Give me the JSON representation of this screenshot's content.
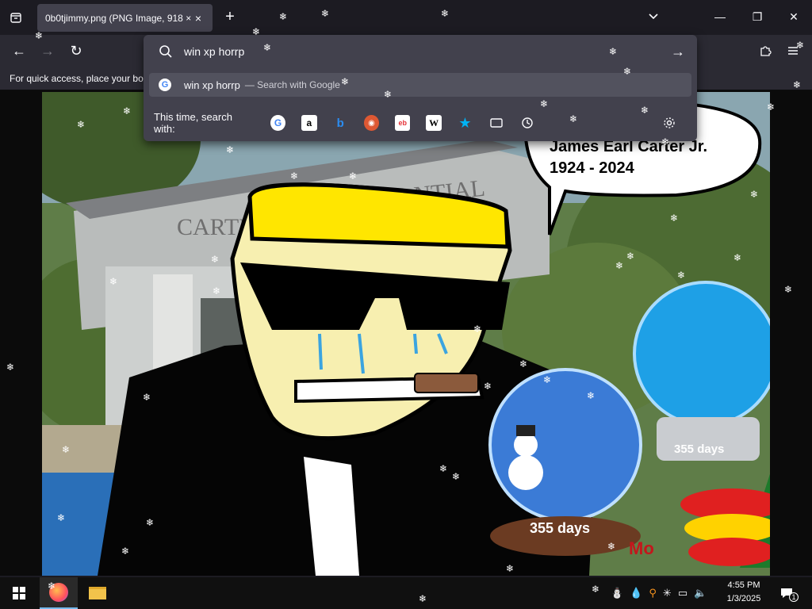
{
  "tab": {
    "title": "0b0tjimmy.png (PNG Image, 918 ×",
    "close": "×"
  },
  "newtab": "+",
  "window": {
    "minimize": "—",
    "maximize": "❐",
    "close": "✕"
  },
  "nav": {
    "back": "←",
    "forward": "→",
    "reload": "↻"
  },
  "urlbar": {
    "value": "win xp horrp",
    "go": "→"
  },
  "suggestion": {
    "text": "win xp horrp",
    "suffix": "— Search with Google"
  },
  "search_with": {
    "label": "This time, search with:",
    "engines": [
      "google-icon",
      "amazon-icon",
      "bing-icon",
      "duckduckgo-icon",
      "ebay-icon",
      "wikipedia-icon",
      "bookmarks-icon",
      "tabs-icon",
      "history-icon"
    ]
  },
  "bookmarks_bar": {
    "text": "For quick access, place your boo"
  },
  "image": {
    "sign_text": "CARTE",
    "sign_text2": "NTIAL",
    "bubble_line1": "James Earl Carter Jr.",
    "bubble_line2": "1924 - 2024",
    "globe_left_label": "355 days",
    "globe_right_label": "355 days",
    "bottom_text": "Mo"
  },
  "taskbar": {
    "time": "4:55 PM",
    "date": "1/3/2025",
    "notification_count": "1"
  },
  "colors": {
    "chrome_dark": "#1c1b22",
    "toolbar": "#2b2a33",
    "panel": "#42414d",
    "bubble_text": "#c4161c",
    "highlight": "#52525e"
  }
}
